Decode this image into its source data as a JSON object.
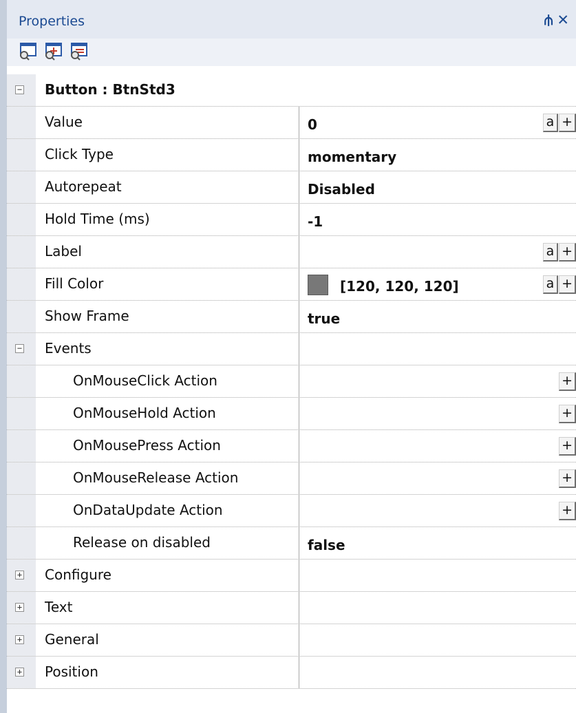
{
  "panel": {
    "title": "Properties",
    "pin_glyph": "⫛",
    "close_glyph": "✕"
  },
  "toolbar": {
    "icons": [
      "properties-view-icon",
      "events-view-icon",
      "advanced-view-icon"
    ]
  },
  "object_header": "Button : BtnStd3",
  "properties": [
    {
      "name": "Value",
      "value": "0",
      "buttons": [
        "a",
        "+"
      ]
    },
    {
      "name": "Click Type",
      "value": "momentary",
      "buttons": []
    },
    {
      "name": "Autorepeat",
      "value": "Disabled",
      "buttons": []
    },
    {
      "name": "Hold Time (ms)",
      "value": "-1",
      "buttons": []
    },
    {
      "name": "Label",
      "value": "",
      "buttons": [
        "a",
        "+"
      ]
    },
    {
      "name": "Fill Color",
      "value": "[120, 120, 120]",
      "swatch": "#787878",
      "buttons": [
        "a",
        "+"
      ]
    },
    {
      "name": "Show Frame",
      "value": "true",
      "buttons": []
    }
  ],
  "events_header": "Events",
  "events": [
    {
      "name": "OnMouseClick Action",
      "value": "",
      "buttons": [
        "+"
      ]
    },
    {
      "name": "OnMouseHold Action",
      "value": "",
      "buttons": [
        "+"
      ]
    },
    {
      "name": "OnMousePress Action",
      "value": "",
      "buttons": [
        "+"
      ]
    },
    {
      "name": "OnMouseRelease Action",
      "value": "",
      "buttons": [
        "+"
      ]
    },
    {
      "name": "OnDataUpdate Action",
      "value": "",
      "buttons": [
        "+"
      ]
    },
    {
      "name": "Release on disabled",
      "value": "false",
      "buttons": []
    }
  ],
  "collapsed_categories": [
    "Configure",
    "Text",
    "General",
    "Position"
  ],
  "expander": {
    "expanded": "−",
    "collapsed": "+"
  },
  "colors": {
    "title_text": "#1b4a92",
    "fill_color_swatch": "#787878"
  }
}
